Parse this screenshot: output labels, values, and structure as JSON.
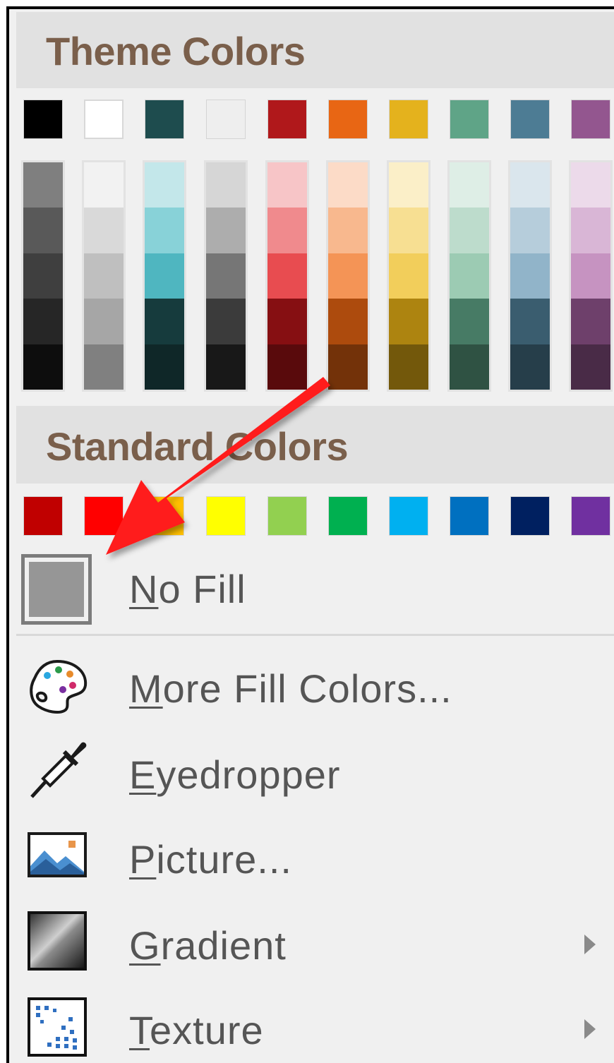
{
  "theme_colors": {
    "header": "Theme Colors",
    "base": [
      {
        "name": "black",
        "hex": "#000000"
      },
      {
        "name": "white",
        "hex": "#ffffff"
      },
      {
        "name": "dark-teal",
        "hex": "#1e4c4e"
      },
      {
        "name": "light-gray",
        "hex": "#eeeeee"
      },
      {
        "name": "dark-red",
        "hex": "#b0181b"
      },
      {
        "name": "orange",
        "hex": "#e86614"
      },
      {
        "name": "gold",
        "hex": "#e4b21d"
      },
      {
        "name": "sea-green",
        "hex": "#5fa487"
      },
      {
        "name": "steel-blue",
        "hex": "#4d7c94"
      },
      {
        "name": "purple",
        "hex": "#93568f"
      }
    ],
    "shades": [
      [
        "#7f7f7f",
        "#595959",
        "#3f3f3f",
        "#262626",
        "#0d0d0d"
      ],
      [
        "#f2f2f2",
        "#d9d9d9",
        "#bfbfbf",
        "#a6a6a6",
        "#808080"
      ],
      [
        "#c3e7ea",
        "#88d2d8",
        "#4fb6c0",
        "#163b3d",
        "#0f2728"
      ],
      [
        "#d6d6d6",
        "#adadad",
        "#767676",
        "#3b3b3b",
        "#181818"
      ],
      [
        "#f7c5c7",
        "#f08a8d",
        "#e84c50",
        "#860f12",
        "#590a0c"
      ],
      [
        "#fcdbc7",
        "#f8b88e",
        "#f49456",
        "#ad4b0d",
        "#733209"
      ],
      [
        "#fbefc8",
        "#f7df92",
        "#f2ce5b",
        "#ad8410",
        "#73580b"
      ],
      [
        "#deeee6",
        "#bddccc",
        "#9ccbb3",
        "#477b65",
        "#2f5243"
      ],
      [
        "#dae6ed",
        "#b6cddb",
        "#91b4c9",
        "#3a5d6f",
        "#263e4a"
      ],
      [
        "#ecdaea",
        "#d9b6d6",
        "#c693c1",
        "#6e406b",
        "#492b47"
      ]
    ]
  },
  "standard_colors": {
    "header": "Standard Colors",
    "colors": [
      {
        "name": "dark-red",
        "hex": "#c00000"
      },
      {
        "name": "red",
        "hex": "#ff0000"
      },
      {
        "name": "orange",
        "hex": "#ffc000"
      },
      {
        "name": "yellow",
        "hex": "#ffff00"
      },
      {
        "name": "light-green",
        "hex": "#92d050"
      },
      {
        "name": "green",
        "hex": "#00b050"
      },
      {
        "name": "light-blue",
        "hex": "#00b0f0"
      },
      {
        "name": "blue",
        "hex": "#0070c0"
      },
      {
        "name": "dark-blue",
        "hex": "#002060"
      },
      {
        "name": "purple",
        "hex": "#7030a0"
      }
    ]
  },
  "menu": {
    "no_fill": {
      "mnemonic": "N",
      "rest": "o Fill"
    },
    "more_fill_colors": {
      "mnemonic": "M",
      "rest": "ore Fill Colors..."
    },
    "eyedropper": {
      "mnemonic": "E",
      "rest": "yedropper"
    },
    "picture": {
      "mnemonic": "P",
      "rest": "icture..."
    },
    "gradient": {
      "mnemonic": "G",
      "rest": "radient"
    },
    "texture": {
      "mnemonic": "T",
      "rest": "exture"
    }
  },
  "icons": {
    "more_fill_colors": "palette-icon",
    "eyedropper": "eyedropper-icon",
    "picture": "picture-icon",
    "gradient": "gradient-icon",
    "texture": "texture-icon",
    "submenu": "chevron-right-icon"
  },
  "annotation": {
    "color": "#ff1a1a",
    "description": "red arrow pointing to No Fill"
  }
}
